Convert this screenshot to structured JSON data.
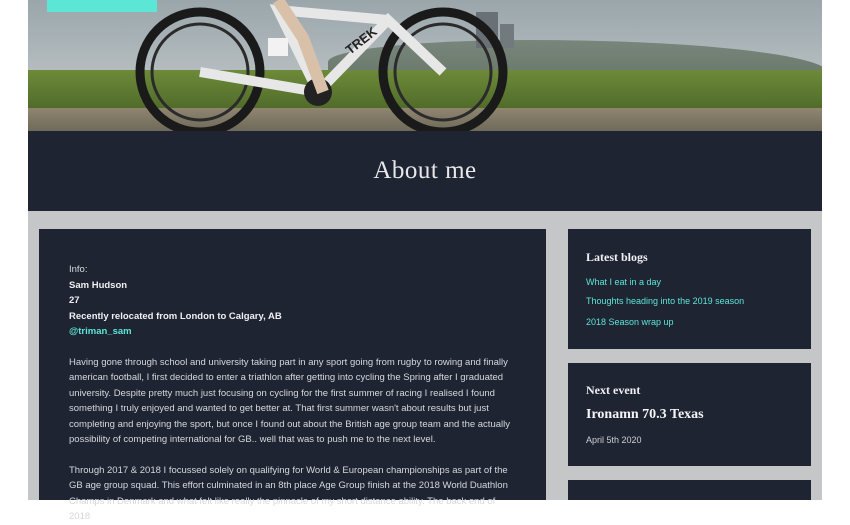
{
  "page": {
    "hero_alt": "Cyclist on a Trek road bike",
    "bike_brand": "TREK",
    "title": "About me"
  },
  "main": {
    "info_label": "Info:",
    "name": "Sam Hudson",
    "age": "27",
    "relocated": "Recently relocated from London to Calgary, AB",
    "handle": "@triman_sam",
    "paragraphs": [
      "Having gone through school and university taking part in any sport going from rugby to rowing and finally american football, I first decided to enter a triathlon after getting into cycling the Spring after I graduated university. Despite pretty much just focusing on cycling for the first summer of racing I realised I found something I truly enjoyed and wanted to get better at. That first summer wasn't about results but just completing and enjoying the sport, but once I found out about the British age group team and the actually possibility of competing international for GB.. well that was to push me to the next level.",
      "Through 2017 & 2018 I focussed solely on qualifying for World & European championships as part of the GB age group squad. This effort culminated in an 8th place Age Group finish at the 2018 World Duathlon Champs in Denmark and what felt like really the pinnacle of my short distance ability. The back end of 2018"
    ]
  },
  "sidebar": {
    "latest_blogs": {
      "heading": "Latest blogs",
      "links": [
        "What I eat in a day",
        "Thoughts heading into the 2019 season",
        "2018 Season wrap up"
      ]
    },
    "next_event": {
      "heading": "Next event",
      "name": "Ironamn 70.3 Texas",
      "date": "April 5th 2020"
    }
  },
  "colors": {
    "accent": "#5ce6d6",
    "card_bg": "#1f2433",
    "page_bg": "#c4c6c8"
  }
}
